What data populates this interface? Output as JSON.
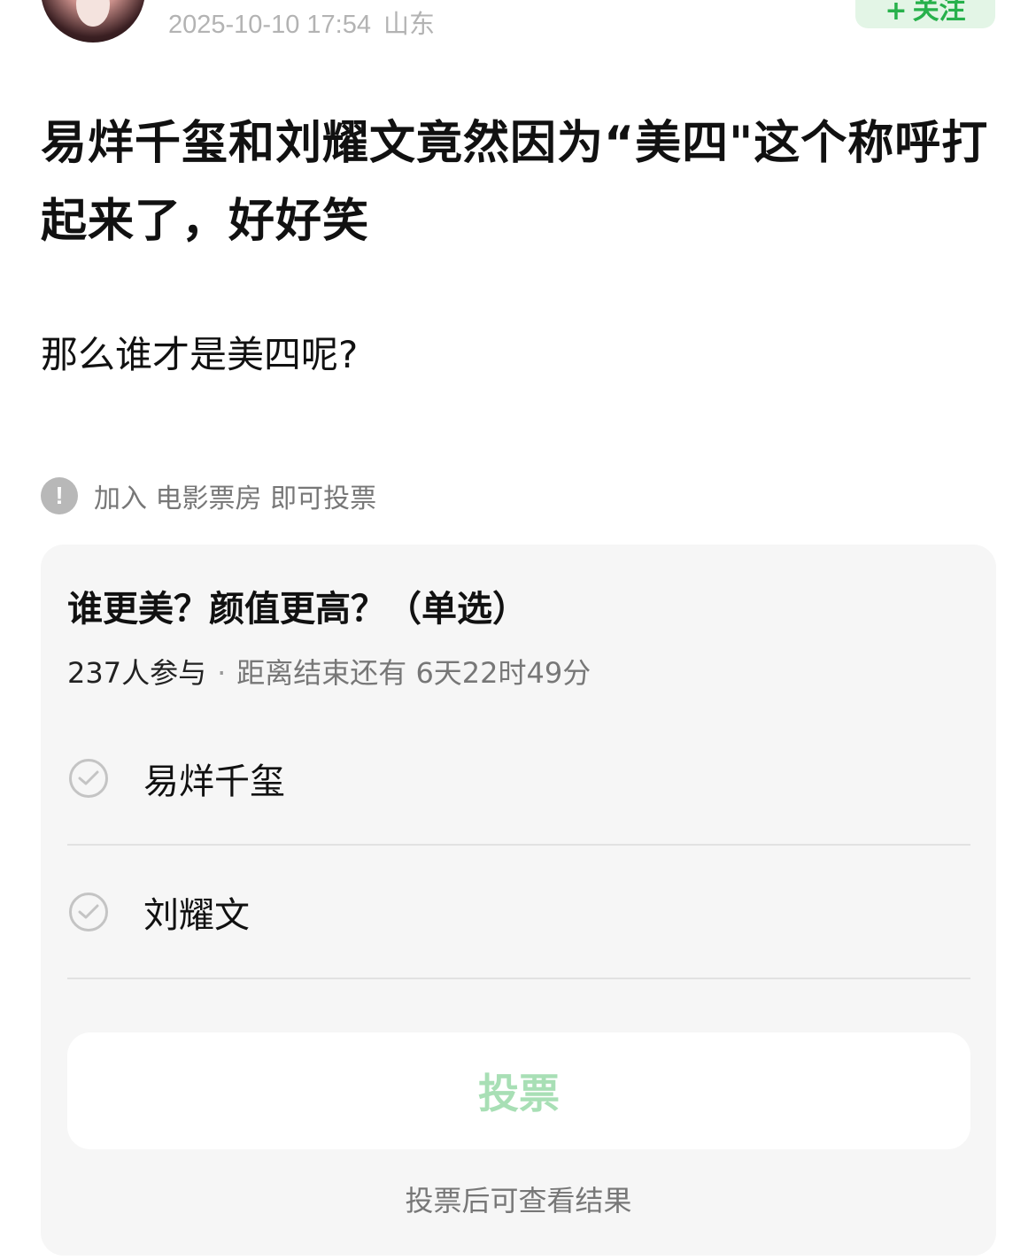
{
  "header": {
    "timestamp": "2025-10-10 17:54",
    "location": "山东",
    "follow_label": "关注",
    "follow_icon": "plus-icon"
  },
  "post": {
    "title": "易烊千玺和刘耀文竟然因为“美四\"这个称呼打起来了，好好笑",
    "body": "那么谁才是美四呢?"
  },
  "notice": {
    "icon": "exclamation-icon",
    "text": "加入 电影票房 即可投票"
  },
  "poll": {
    "question": "谁更美？颜值更高？（单选）",
    "participants": "237人参与",
    "separator": "·",
    "time_left": "距离结束还有 6天22时49分",
    "options": [
      {
        "label": "易烊千玺"
      },
      {
        "label": "刘耀文"
      }
    ],
    "vote_label": "投票",
    "hint": "投票后可查看结果"
  },
  "colors": {
    "accent_green": "#27b14b",
    "vote_disabled": "#a8dfb5",
    "card_bg": "#f6f6f6"
  }
}
